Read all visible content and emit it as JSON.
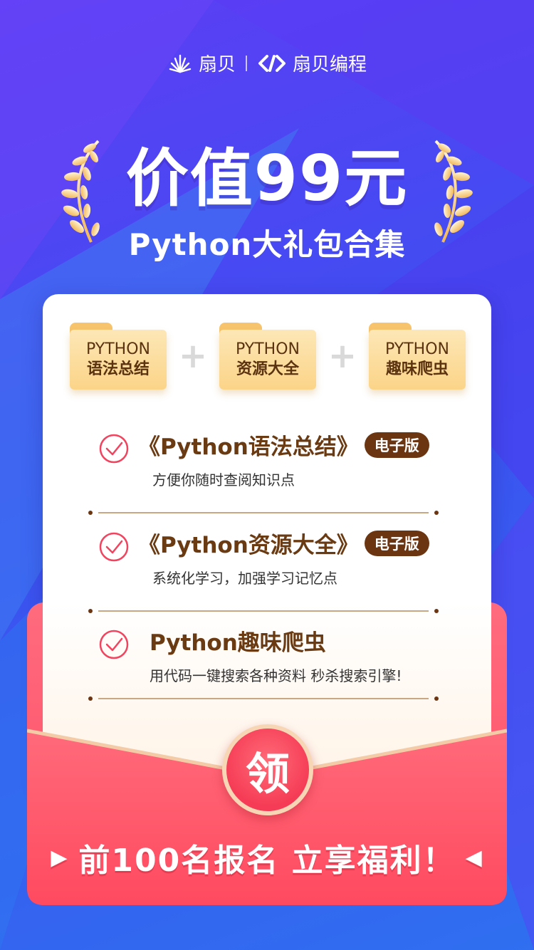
{
  "brand": {
    "name1": "扇贝",
    "name2": "扇贝编程",
    "icon1": "sunburst-logo-icon",
    "icon2": "code-link-logo-icon"
  },
  "headline": "价值99元",
  "subhead": "Python大礼包合集",
  "folders": [
    {
      "line1": "PYTHON",
      "line2": "语法总结"
    },
    {
      "line1": "PYTHON",
      "line2": "资源大全"
    },
    {
      "line1": "PYTHON",
      "line2": "趣味爬虫"
    }
  ],
  "plus": "+",
  "items": [
    {
      "title": "《Python语法总结》",
      "badge": "电子版",
      "desc": "方便你随时查阅知识点"
    },
    {
      "title": "《Python资源大全》",
      "badge": "电子版",
      "desc": "系统化学习，加强学习记忆点"
    },
    {
      "title": "Python趣味爬虫",
      "badge": "",
      "desc": "用代码一键搜索各种资料 秒杀搜索引擎!"
    }
  ],
  "seal": "领",
  "cta": {
    "text": "前100名报名 立享福利！",
    "left_arrow": "▶",
    "right_arrow": "◀"
  },
  "colors": {
    "bg_top": "#5d3df5",
    "bg_bottom": "#2f6ff0",
    "brown": "#6b3512",
    "red": "#ff4c63",
    "folder": "#fbd488"
  }
}
